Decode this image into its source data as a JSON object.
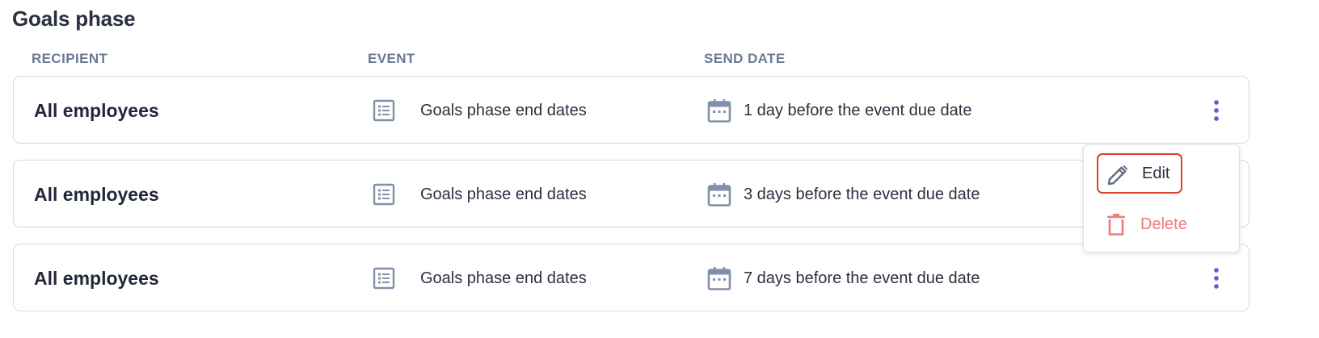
{
  "section": {
    "title": "Goals phase"
  },
  "columns": {
    "recipient": "RECIPIENT",
    "event": "EVENT",
    "send_date": "SEND DATE"
  },
  "rows": [
    {
      "recipient": "All employees",
      "event": "Goals phase end dates",
      "send_date": "1 day before the event due date",
      "event_icon": "list-icon",
      "date_icon": "calendar-icon",
      "menu_icon": "kebab-menu-icon"
    },
    {
      "recipient": "All employees",
      "event": "Goals phase end dates",
      "send_date": "3 days before the event due date",
      "event_icon": "list-icon",
      "date_icon": "calendar-icon"
    },
    {
      "recipient": "All employees",
      "event": "Goals phase end dates",
      "send_date": "7 days before the event due date",
      "event_icon": "list-icon",
      "date_icon": "calendar-icon",
      "menu_icon": "kebab-menu-icon"
    }
  ],
  "context_menu": {
    "edit": {
      "label": "Edit",
      "icon": "pencil-icon"
    },
    "delete": {
      "label": "Delete",
      "icon": "trash-icon"
    }
  },
  "colors": {
    "accent": "#6a5ec9",
    "icon_gray": "#8190a8",
    "focus_ring": "#d9412e",
    "danger": "#f07a7a",
    "header_text": "#6b7893",
    "border": "#d5d9e2"
  }
}
